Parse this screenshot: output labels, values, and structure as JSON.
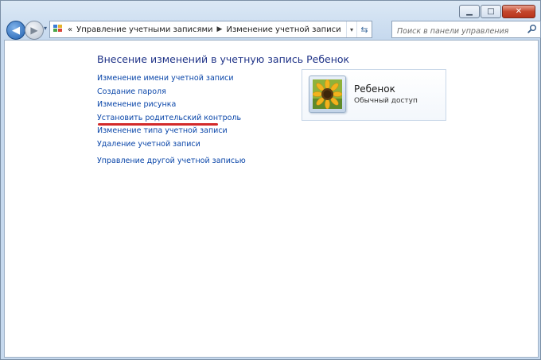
{
  "window": {
    "caption": {
      "minimize": "▁",
      "maximize": "□",
      "close": "✕"
    }
  },
  "nav": {
    "back_glyph": "◀",
    "forward_glyph": "▶",
    "history_glyph": "▾"
  },
  "address": {
    "prefix": "«",
    "breadcrumbs": [
      "Управление учетными записями",
      "Изменение учетной записи"
    ],
    "separator": "▶",
    "dropdown_glyph": "▾",
    "refresh_glyph": "⇆",
    "icon": "control-panel-icon"
  },
  "search": {
    "placeholder": "Поиск в панели управления",
    "icon": "search-icon"
  },
  "main": {
    "heading": "Внесение изменений в учетную запись Ребенок",
    "links": [
      "Изменение имени учетной записи",
      "Создание пароля",
      "Изменение рисунка",
      "Установить родительский контроль",
      "Изменение типа учетной записи",
      "Удаление учетной записи"
    ],
    "other_link": "Управление другой учетной записью"
  },
  "account": {
    "name": "Ребенок",
    "type": "Обычный доступ",
    "picture": "sunflower-icon"
  },
  "colors": {
    "heading": "#1e3287",
    "link": "#0a46a9",
    "highlight_mark": "#d32a2a",
    "window_frame": "#c6d9ee"
  }
}
